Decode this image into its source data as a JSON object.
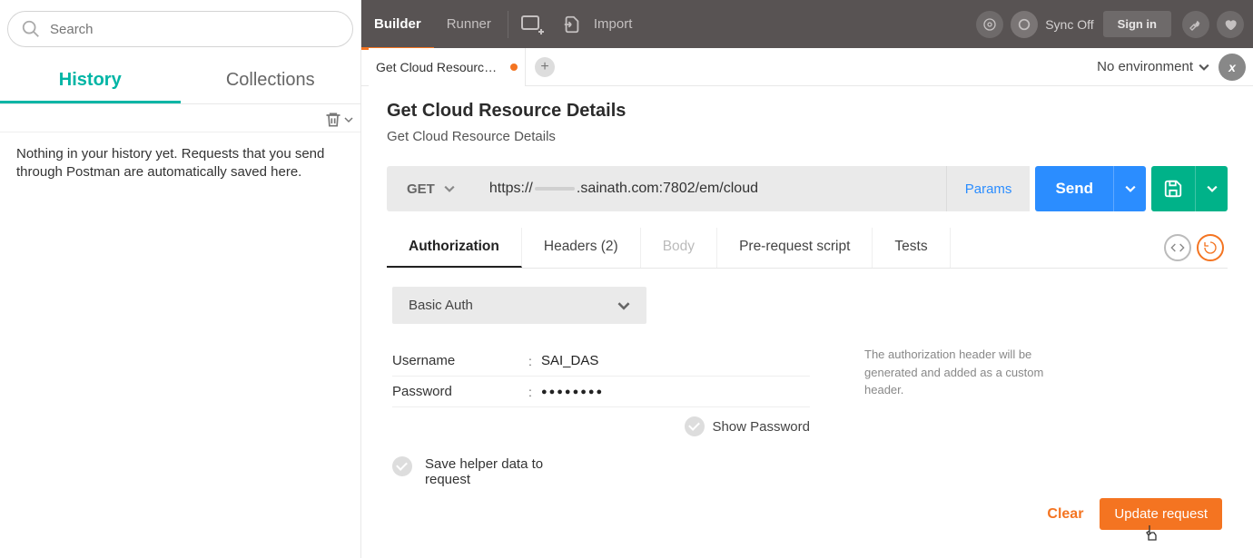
{
  "sidebar": {
    "search_placeholder": "Search",
    "tabs": {
      "history": "History",
      "collections": "Collections"
    },
    "empty_text": "Nothing in your history yet. Requests that you send through Postman are automatically saved here."
  },
  "topbar": {
    "builder": "Builder",
    "runner": "Runner",
    "import": "Import",
    "sync": "Sync Off",
    "signin": "Sign in"
  },
  "tabstrip": {
    "open_tab": "Get Cloud Resource …",
    "env_label": "No environment",
    "env_vars_glyph": "x"
  },
  "request": {
    "title": "Get Cloud Resource Details",
    "description": "Get Cloud Resource Details",
    "method": "GET",
    "url_prefix": "https://",
    "url_suffix": ".sainath.com:7802/em/cloud",
    "params": "Params",
    "send": "Send"
  },
  "reqtabs": {
    "authorization": "Authorization",
    "headers": "Headers (2)",
    "body": "Body",
    "prerequest": "Pre-request script",
    "tests": "Tests"
  },
  "auth": {
    "type": "Basic Auth",
    "username_label": "Username",
    "username_value": "SAI_DAS",
    "password_label": "Password",
    "password_value": "●●●●●●●●",
    "show_password": "Show Password",
    "helper_label": "Save helper data to request",
    "help_text": "The authorization header will be generated and added as a custom header.",
    "clear": "Clear",
    "update": "Update request"
  }
}
